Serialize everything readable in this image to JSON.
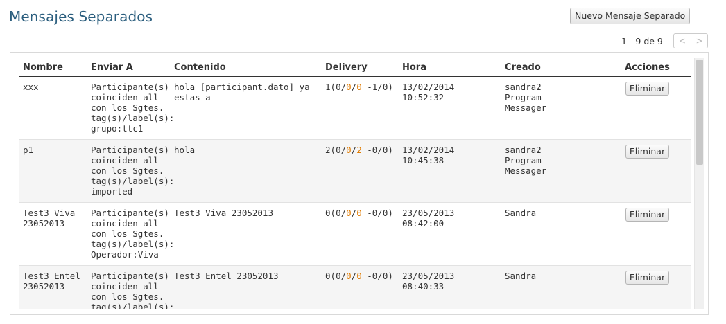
{
  "header": {
    "title": "Mensajes Separados",
    "new_button_label": "Nuevo Mensaje Separado"
  },
  "pager": {
    "range_text": "1 - 9 de 9",
    "prev_label": "<",
    "next_label": ">"
  },
  "table": {
    "columns": {
      "nombre": "Nombre",
      "enviar_a": "Enviar A",
      "contenido": "Contenido",
      "delivery": "Delivery",
      "hora": "Hora",
      "creado": "Creado",
      "acciones": "Acciones"
    },
    "rows": [
      {
        "nombre": "xxx",
        "enviar_a": "Participante(s)\ncoinciden all\ncon los Sgtes.\ntag(s)/label(s):\ngrupo:ttc1",
        "contenido": "hola [participant.dato] ya\nestas a",
        "delivery": {
          "pre": "1(",
          "a": "0",
          "sep1": "/",
          "b": "0",
          "sep2": "/",
          "c": "0",
          "post": " -1/0)"
        },
        "hora": "13/02/2014\n10:52:32",
        "creado": "sandra2\nProgram\nMessager",
        "action_label": "Eliminar"
      },
      {
        "nombre": "p1",
        "enviar_a": "Participante(s)\ncoinciden all\ncon los Sgtes.\ntag(s)/label(s):\nimported",
        "contenido": "hola",
        "delivery": {
          "pre": "2(",
          "a": "0",
          "sep1": "/",
          "b": "0",
          "sep2": "/",
          "c": "2",
          "post": " -0/0)"
        },
        "hora": "13/02/2014\n10:45:38",
        "creado": "sandra2\nProgram\nMessager",
        "action_label": "Eliminar"
      },
      {
        "nombre": "Test3 Viva\n23052013",
        "enviar_a": "Participante(s)\ncoinciden all\ncon los Sgtes.\ntag(s)/label(s):\nOperador:Viva",
        "contenido": "Test3 Viva 23052013",
        "delivery": {
          "pre": "0(",
          "a": "0",
          "sep1": "/",
          "b": "0",
          "sep2": "/",
          "c": "0",
          "post": " -0/0)"
        },
        "hora": "23/05/2013\n08:42:00",
        "creado": "Sandra",
        "action_label": "Eliminar"
      },
      {
        "nombre": "Test3 Entel\n23052013",
        "enviar_a": "Participante(s)\ncoinciden all\ncon los Sgtes.\ntag(s)/label(s):",
        "contenido": "Test3 Entel 23052013",
        "delivery": {
          "pre": "0(",
          "a": "0",
          "sep1": "/",
          "b": "0",
          "sep2": "/",
          "c": "0",
          "post": " -0/0)"
        },
        "hora": "23/05/2013\n08:40:33",
        "creado": "Sandra",
        "action_label": "Eliminar"
      }
    ]
  },
  "colors": {
    "title": "#2b5e7e",
    "delivery_highlight": "#e07b00",
    "row_alt": "#f5f5f5"
  }
}
